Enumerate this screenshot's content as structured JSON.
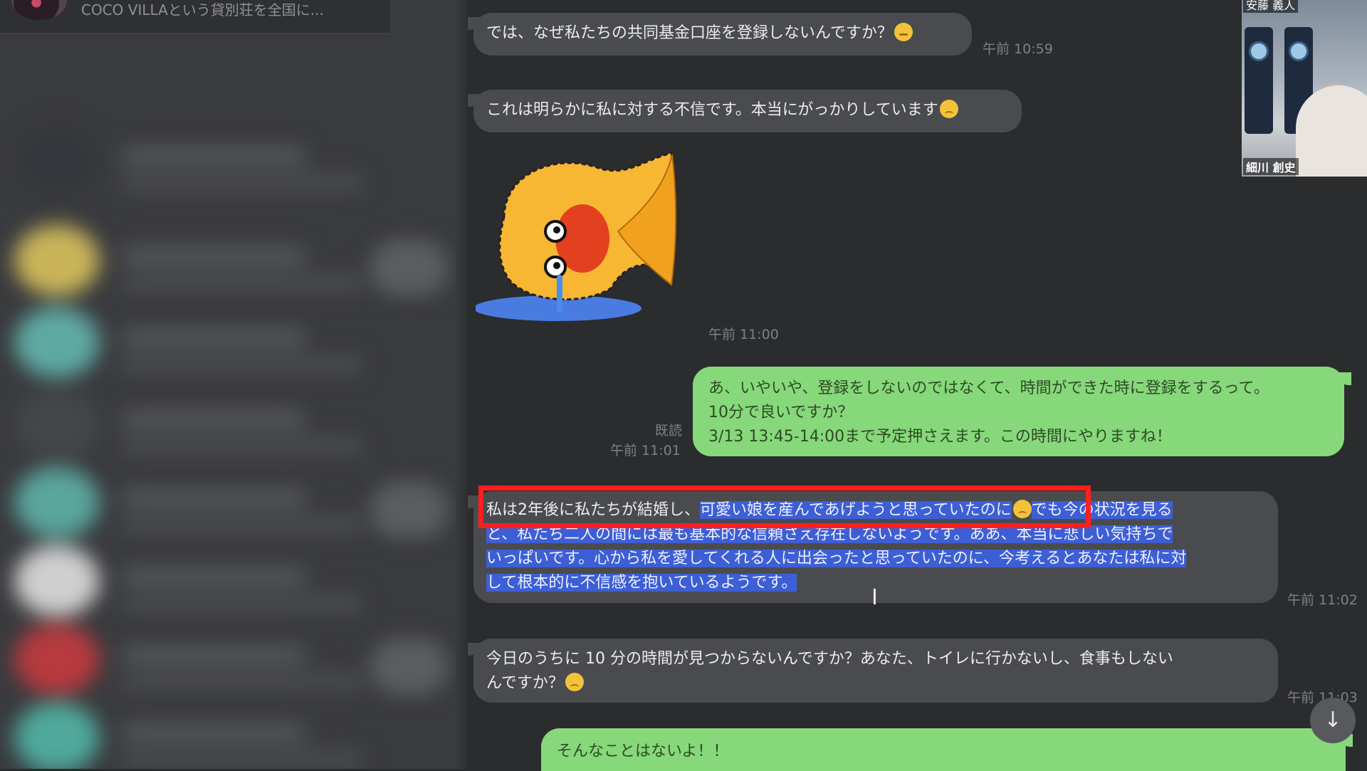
{
  "sidebar": {
    "top_preview": "COCO VILLAという貸別荘を全国に..."
  },
  "video": {
    "name_top": "安藤 義人",
    "name_bottom": "細川 創史"
  },
  "messages": {
    "m1": {
      "text": "では、なぜ私たちの共同基金口座を登録しないんですか？",
      "time": "午前 10:59"
    },
    "m2": {
      "text": "これは明らかに私に対する不信です。本当にがっかりしています",
      "time": ""
    },
    "sticker": {
      "time": "午前 11:00"
    },
    "m3": {
      "line1": "あ、いやいや、登録をしないのではなくて、時間ができた時に登録をするって。",
      "line2": "10分で良いですか？",
      "line3": "3/13 13:45-14:00まで予定押さえます。この時間にやりますね！",
      "read": "既読",
      "time": "午前 11:01"
    },
    "m4": {
      "part_a": "私は2年後に私たちが結婚し、",
      "part_b": "可愛い娘を産んであげようと思っていたのに",
      "part_c": "でも今の状況を見る",
      "line2": "と、私たち二人の間には最も基本的な信頼さえ存在しないようです。ああ、本当に悲しい気持ちで",
      "line3": "いっぱいです。心から私を愛してくれる人に出会ったと思っていたのに、今考えるとあなたは私に対",
      "line4": "して根本的に不信感を抱いているようです。",
      "time": "午前 11:02"
    },
    "m5": {
      "line1": "今日のうちに 10 分の時間が見つからないんですか？あなた、トイレに行かないし、食事もしない",
      "line2": "んですか？",
      "time": "午前 11:03"
    },
    "m6": {
      "text": "そんなことはないよ！！"
    }
  },
  "icons": {
    "scroll_down": "↓",
    "cursor": "I"
  },
  "colors": {
    "incoming_bubble": "#4a4b4f",
    "outgoing_bubble": "#86d87a",
    "selection": "#3d5fd6",
    "annotation_box": "#ff1f1f"
  }
}
